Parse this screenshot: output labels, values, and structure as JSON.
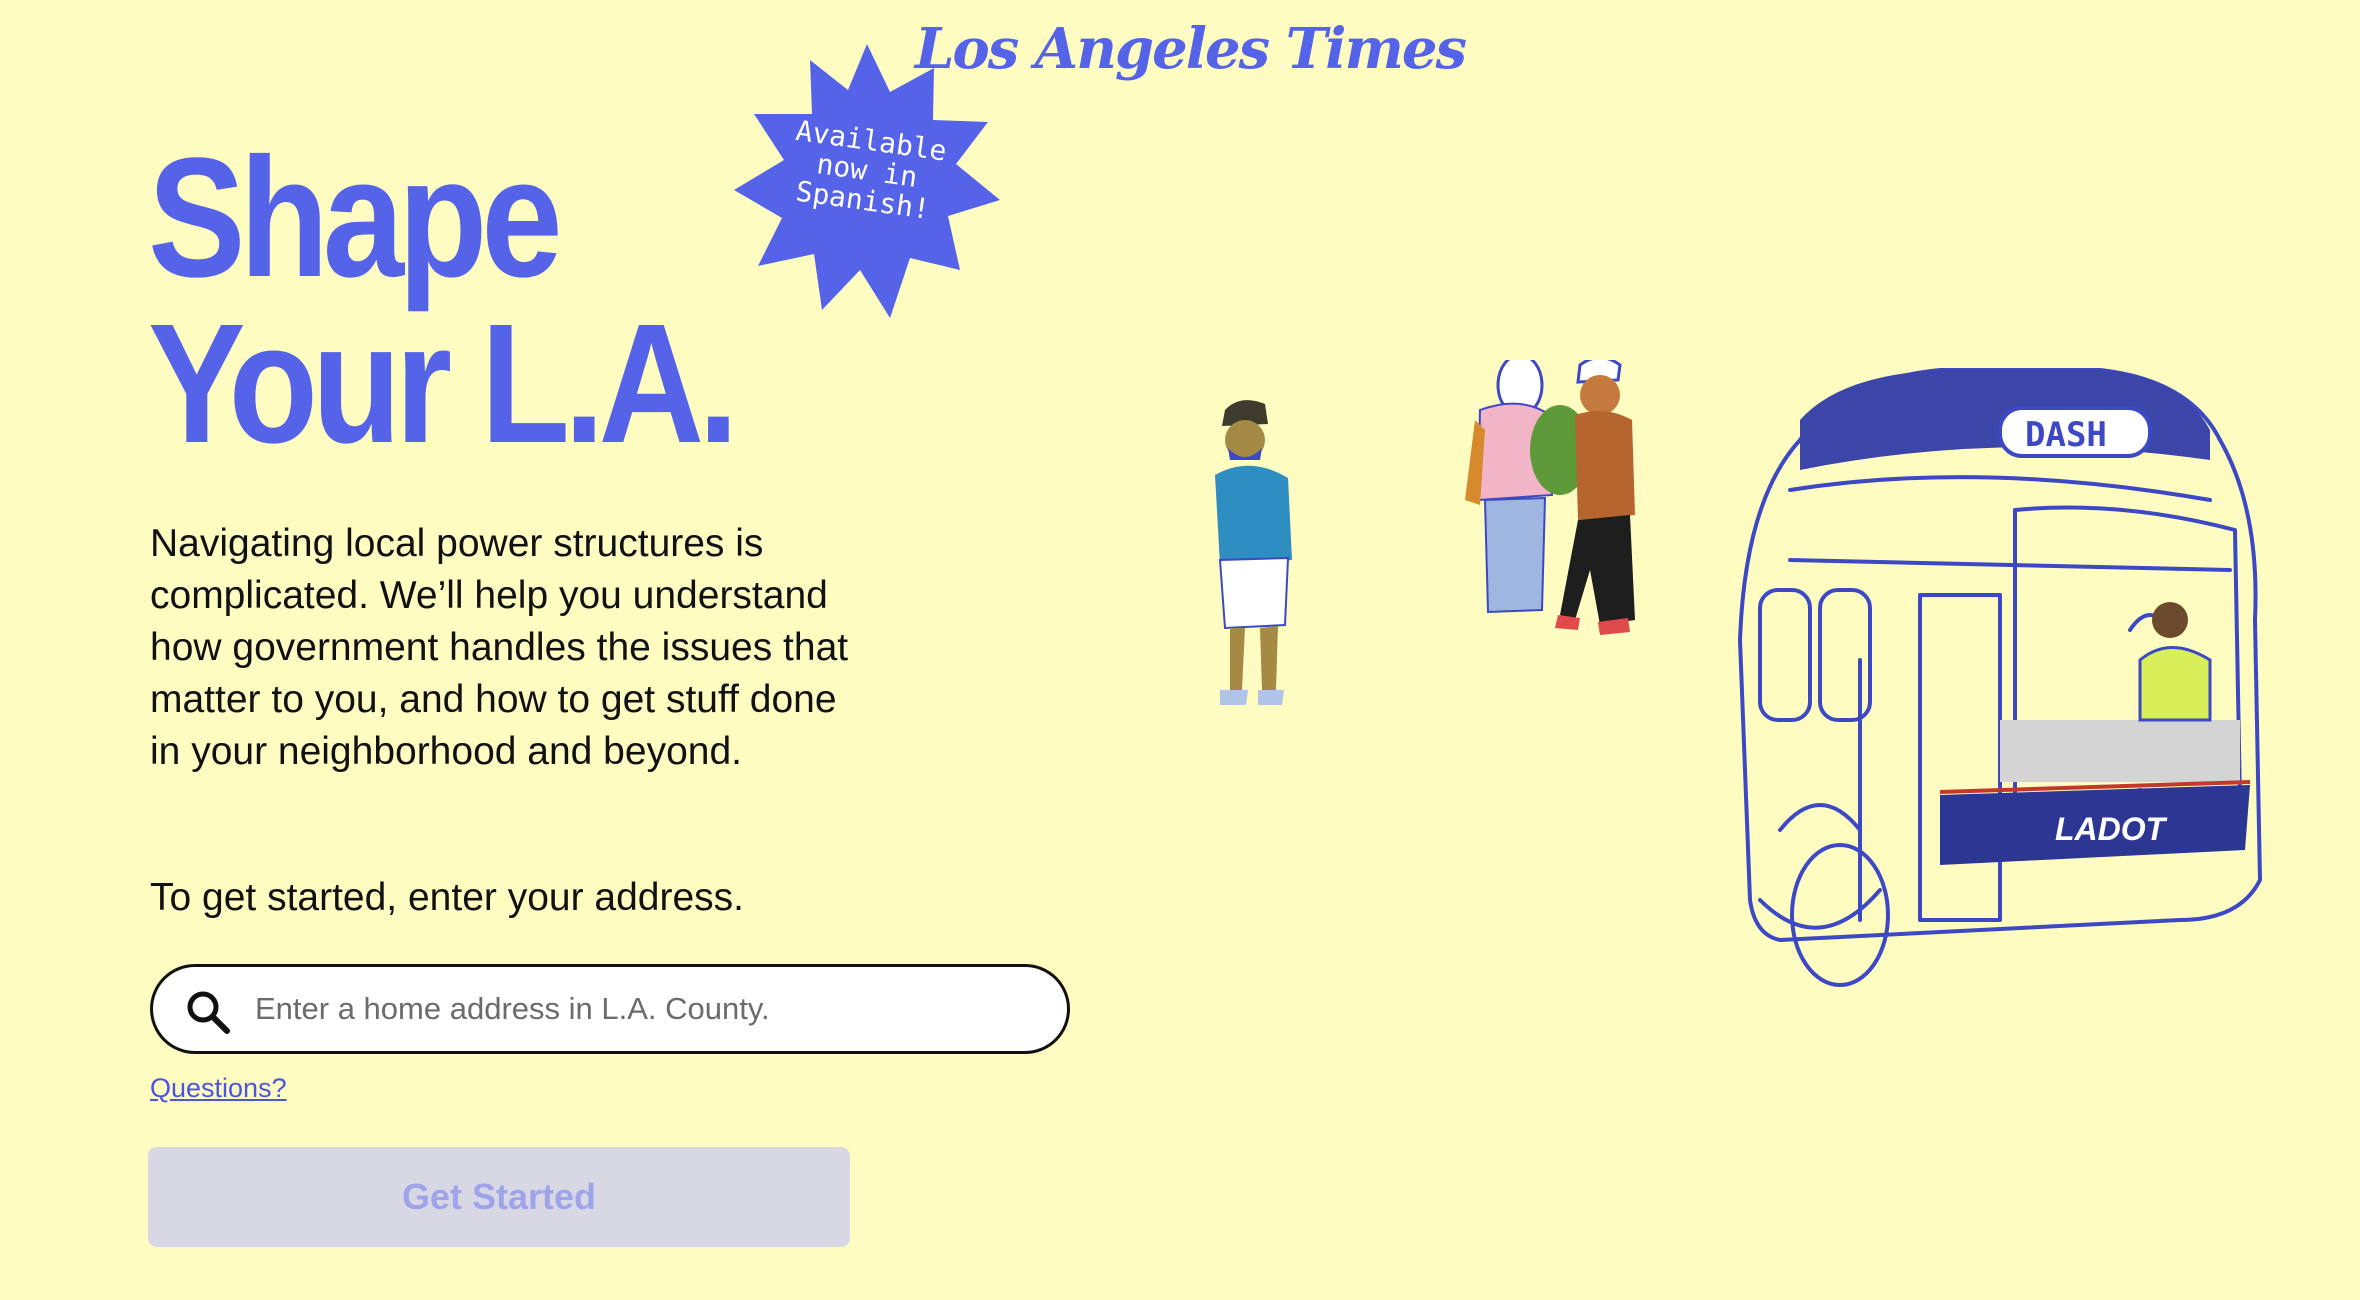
{
  "masthead": {
    "logo_text": "Los Angeles Times"
  },
  "hero": {
    "title_line1": "Shape",
    "title_line2": "Your L.A.",
    "badge_text": "Available now in Spanish!"
  },
  "intro": {
    "paragraph": "Navigating local power structures is complicated. We’ll help you understand how government handles the issues that matter to you, and how to get stuff done in your neighborhood and beyond.",
    "cta": "To get started, enter your address."
  },
  "search": {
    "placeholder": "Enter a home address in L.A. County.",
    "value": ""
  },
  "links": {
    "questions": "Questions?"
  },
  "buttons": {
    "get_started": "Get Started"
  },
  "illustration": {
    "bus_sign": "DASH",
    "bus_front_label": "LADOT"
  },
  "colors": {
    "background": "#fffcc2",
    "brand_blue": "#5563e8",
    "button_disabled_bg": "#d8d8e4",
    "button_disabled_text": "#9ea3ea"
  }
}
